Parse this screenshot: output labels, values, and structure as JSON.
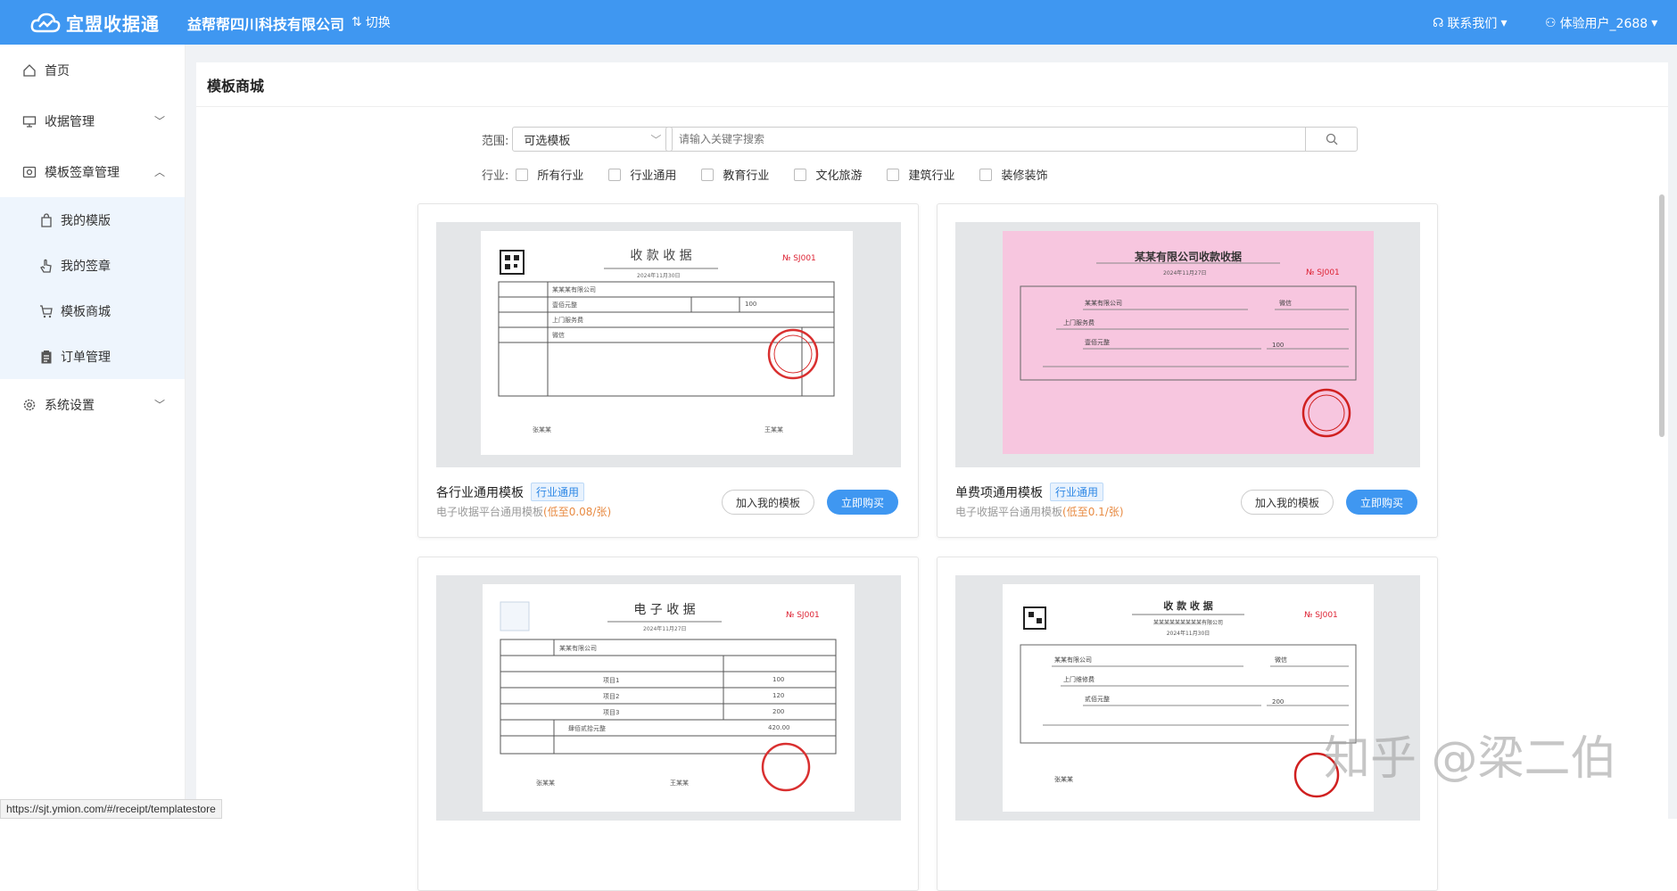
{
  "header": {
    "app_name": "宜盟收据通",
    "company": "益帮帮四川科技有限公司",
    "switch_label": "切换",
    "contact_label": "联系我们",
    "user_label": "体验用户_2688",
    "accent_color": "#3f97f1"
  },
  "sidebar": {
    "items": [
      {
        "label": "首页",
        "icon": "home-icon"
      },
      {
        "label": "收据管理",
        "icon": "receipt-icon"
      },
      {
        "label": "模板签章管理",
        "icon": "template-icon"
      },
      {
        "label": "系统设置",
        "icon": "gear-icon"
      }
    ],
    "subitems": [
      {
        "label": "我的模版",
        "icon": "bag-icon"
      },
      {
        "label": "我的签章",
        "icon": "hand-icon"
      },
      {
        "label": "模板商城",
        "icon": "cart-icon"
      },
      {
        "label": "订单管理",
        "icon": "clipboard-icon"
      }
    ]
  },
  "page": {
    "title": "模板商城",
    "scope_label": "范围:",
    "scope_value": "可选模板",
    "search_placeholder": "请输入关键字搜索",
    "industry_label": "行业:",
    "industries": [
      "所有行业",
      "行业通用",
      "教育行业",
      "文化旅游",
      "建筑行业",
      "装修装饰"
    ]
  },
  "cards": [
    {
      "title": "各行业通用模板",
      "tag": "行业通用",
      "desc": "电子收据平台通用模板",
      "price": "(低至0.08/张)",
      "add_label": "加入我的模板",
      "buy_label": "立即购买",
      "receipt": {
        "heading": "收 款 收 据",
        "number": "№ SJ001",
        "date": "2024年11月30日",
        "payer": "某某某有限公司",
        "amount_cn": "壹佰元整",
        "amount": "100",
        "item": "上门服务费",
        "method": "微信",
        "issuer": "张某某",
        "receiver": "王某某"
      }
    },
    {
      "title": "单费项通用模板",
      "tag": "行业通用",
      "desc": "电子收据平台通用模板",
      "price": "(低至0.1/张)",
      "add_label": "加入我的模板",
      "buy_label": "立即购买",
      "receipt": {
        "heading": "某某有限公司收款收据",
        "number": "№ SJ001",
        "date": "2024年11月27日",
        "payer": "某某有限公司",
        "method": "微信",
        "content": "上门服务费",
        "amount_cn": "壹佰元整",
        "amount": "100"
      }
    },
    {
      "title": "",
      "receipt": {
        "heading": "电 子 收 据",
        "number": "№ SJ001",
        "date": "2024年11月27日",
        "customer": "某某有限公司",
        "rows": [
          {
            "item": "项目1",
            "amount": "100"
          },
          {
            "item": "项目2",
            "amount": "120"
          },
          {
            "item": "项目3",
            "amount": "200"
          }
        ],
        "total_cn": "肆佰贰拾元整",
        "total": "420.00",
        "issuer": "张某某",
        "receiver": "王某某"
      }
    },
    {
      "title": "",
      "receipt": {
        "heading": "收 款 收 据",
        "subheading": "某某某某某某某某某有限公司",
        "number": "№ SJ001",
        "date": "2024年11月30日",
        "payer": "某某有限公司",
        "method": "微信",
        "matter": "上门维修费",
        "amount_cn": "贰佰元整",
        "amount": "200",
        "issuer": "张某某"
      }
    }
  ],
  "status_url": "https://sjt.ymion.com/#/receipt/templatestore",
  "watermark": "知乎 @梁二伯"
}
